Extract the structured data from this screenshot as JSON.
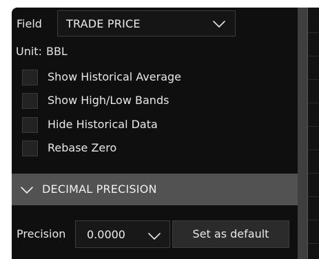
{
  "field": {
    "label": "Field",
    "selected": "TRADE PRICE"
  },
  "unit": {
    "label": "Unit:",
    "value": "BBL"
  },
  "options": [
    {
      "label": "Show Historical Average",
      "checked": false
    },
    {
      "label": "Show High/Low Bands",
      "checked": false
    },
    {
      "label": "Hide Historical Data",
      "checked": false
    },
    {
      "label": "Rebase Zero",
      "checked": false
    }
  ],
  "decimal_section": {
    "title": "DECIMAL PRECISION",
    "expanded": true
  },
  "precision": {
    "label": "Precision",
    "selected": "0.0000",
    "default_button": "Set as default"
  },
  "icons": {
    "dropdown": "chevron-down-icon",
    "section_toggle": "chevron-down-icon"
  },
  "colors": {
    "panel_bg": "#0f0f0f",
    "section_header_bg": "#525252",
    "text": "#e6e6e6",
    "checkbox_bg": "#232323"
  }
}
